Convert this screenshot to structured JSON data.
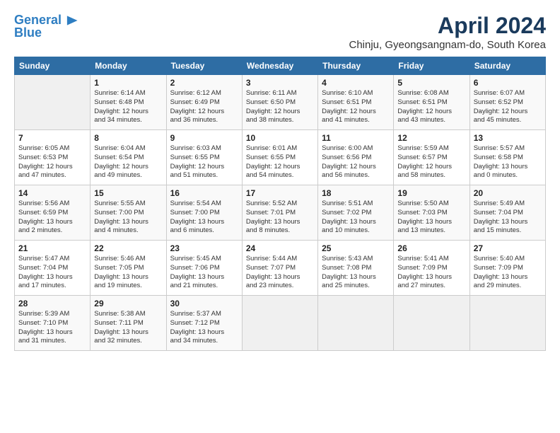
{
  "header": {
    "logo_line1": "General",
    "logo_line2": "Blue",
    "month": "April 2024",
    "location": "Chinju, Gyeongsangnam-do, South Korea"
  },
  "days_of_week": [
    "Sunday",
    "Monday",
    "Tuesday",
    "Wednesday",
    "Thursday",
    "Friday",
    "Saturday"
  ],
  "weeks": [
    [
      {
        "day": "",
        "info": ""
      },
      {
        "day": "1",
        "info": "Sunrise: 6:14 AM\nSunset: 6:48 PM\nDaylight: 12 hours\nand 34 minutes."
      },
      {
        "day": "2",
        "info": "Sunrise: 6:12 AM\nSunset: 6:49 PM\nDaylight: 12 hours\nand 36 minutes."
      },
      {
        "day": "3",
        "info": "Sunrise: 6:11 AM\nSunset: 6:50 PM\nDaylight: 12 hours\nand 38 minutes."
      },
      {
        "day": "4",
        "info": "Sunrise: 6:10 AM\nSunset: 6:51 PM\nDaylight: 12 hours\nand 41 minutes."
      },
      {
        "day": "5",
        "info": "Sunrise: 6:08 AM\nSunset: 6:51 PM\nDaylight: 12 hours\nand 43 minutes."
      },
      {
        "day": "6",
        "info": "Sunrise: 6:07 AM\nSunset: 6:52 PM\nDaylight: 12 hours\nand 45 minutes."
      }
    ],
    [
      {
        "day": "7",
        "info": "Sunrise: 6:05 AM\nSunset: 6:53 PM\nDaylight: 12 hours\nand 47 minutes."
      },
      {
        "day": "8",
        "info": "Sunrise: 6:04 AM\nSunset: 6:54 PM\nDaylight: 12 hours\nand 49 minutes."
      },
      {
        "day": "9",
        "info": "Sunrise: 6:03 AM\nSunset: 6:55 PM\nDaylight: 12 hours\nand 51 minutes."
      },
      {
        "day": "10",
        "info": "Sunrise: 6:01 AM\nSunset: 6:55 PM\nDaylight: 12 hours\nand 54 minutes."
      },
      {
        "day": "11",
        "info": "Sunrise: 6:00 AM\nSunset: 6:56 PM\nDaylight: 12 hours\nand 56 minutes."
      },
      {
        "day": "12",
        "info": "Sunrise: 5:59 AM\nSunset: 6:57 PM\nDaylight: 12 hours\nand 58 minutes."
      },
      {
        "day": "13",
        "info": "Sunrise: 5:57 AM\nSunset: 6:58 PM\nDaylight: 13 hours\nand 0 minutes."
      }
    ],
    [
      {
        "day": "14",
        "info": "Sunrise: 5:56 AM\nSunset: 6:59 PM\nDaylight: 13 hours\nand 2 minutes."
      },
      {
        "day": "15",
        "info": "Sunrise: 5:55 AM\nSunset: 7:00 PM\nDaylight: 13 hours\nand 4 minutes."
      },
      {
        "day": "16",
        "info": "Sunrise: 5:54 AM\nSunset: 7:00 PM\nDaylight: 13 hours\nand 6 minutes."
      },
      {
        "day": "17",
        "info": "Sunrise: 5:52 AM\nSunset: 7:01 PM\nDaylight: 13 hours\nand 8 minutes."
      },
      {
        "day": "18",
        "info": "Sunrise: 5:51 AM\nSunset: 7:02 PM\nDaylight: 13 hours\nand 10 minutes."
      },
      {
        "day": "19",
        "info": "Sunrise: 5:50 AM\nSunset: 7:03 PM\nDaylight: 13 hours\nand 13 minutes."
      },
      {
        "day": "20",
        "info": "Sunrise: 5:49 AM\nSunset: 7:04 PM\nDaylight: 13 hours\nand 15 minutes."
      }
    ],
    [
      {
        "day": "21",
        "info": "Sunrise: 5:47 AM\nSunset: 7:04 PM\nDaylight: 13 hours\nand 17 minutes."
      },
      {
        "day": "22",
        "info": "Sunrise: 5:46 AM\nSunset: 7:05 PM\nDaylight: 13 hours\nand 19 minutes."
      },
      {
        "day": "23",
        "info": "Sunrise: 5:45 AM\nSunset: 7:06 PM\nDaylight: 13 hours\nand 21 minutes."
      },
      {
        "day": "24",
        "info": "Sunrise: 5:44 AM\nSunset: 7:07 PM\nDaylight: 13 hours\nand 23 minutes."
      },
      {
        "day": "25",
        "info": "Sunrise: 5:43 AM\nSunset: 7:08 PM\nDaylight: 13 hours\nand 25 minutes."
      },
      {
        "day": "26",
        "info": "Sunrise: 5:41 AM\nSunset: 7:09 PM\nDaylight: 13 hours\nand 27 minutes."
      },
      {
        "day": "27",
        "info": "Sunrise: 5:40 AM\nSunset: 7:09 PM\nDaylight: 13 hours\nand 29 minutes."
      }
    ],
    [
      {
        "day": "28",
        "info": "Sunrise: 5:39 AM\nSunset: 7:10 PM\nDaylight: 13 hours\nand 31 minutes."
      },
      {
        "day": "29",
        "info": "Sunrise: 5:38 AM\nSunset: 7:11 PM\nDaylight: 13 hours\nand 32 minutes."
      },
      {
        "day": "30",
        "info": "Sunrise: 5:37 AM\nSunset: 7:12 PM\nDaylight: 13 hours\nand 34 minutes."
      },
      {
        "day": "",
        "info": ""
      },
      {
        "day": "",
        "info": ""
      },
      {
        "day": "",
        "info": ""
      },
      {
        "day": "",
        "info": ""
      }
    ]
  ]
}
